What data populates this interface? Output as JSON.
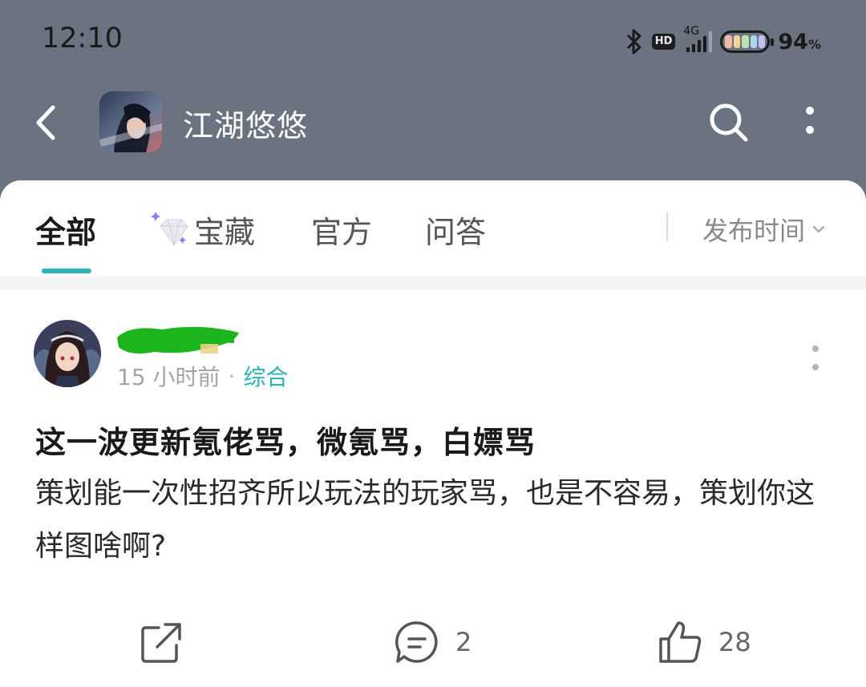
{
  "status_bar": {
    "time": "12:10",
    "icons": [
      "bluetooth-icon",
      "hd-icon",
      "signal-4g-icon",
      "battery-icon"
    ],
    "hd_label": "HD",
    "network": "4G",
    "battery_percent": "94",
    "percent_sign": "%"
  },
  "header": {
    "back_icon": "chevron-left-icon",
    "title": "江湖悠悠",
    "search_icon": "search-icon",
    "more_icon": "more-vertical-icon"
  },
  "tabs": {
    "items": [
      {
        "label": "全部",
        "active": true
      },
      {
        "label": "宝藏",
        "active": false,
        "icon": "diamond-icon"
      },
      {
        "label": "官方",
        "active": false
      },
      {
        "label": "问答",
        "active": false
      }
    ],
    "sort_label": "发布时间",
    "accent_color": "#2bb5b8"
  },
  "post": {
    "author": "",
    "time_ago": "15 小时前",
    "separator": "·",
    "category": "综合",
    "title": "这一波更新氪佬骂，微氪骂，白嫖骂",
    "body": "策划能一次性招齐所以玩法的玩家骂，也是不容易，策划你这样图啥啊?",
    "share_icon": "share-icon",
    "comment_icon": "comment-icon",
    "comment_count": "2",
    "like_icon": "thumbs-up-icon",
    "like_count": "28"
  },
  "colors": {
    "header_bg": "#6b7280",
    "accent": "#2bb5b8",
    "redaction": "#1db51d"
  }
}
